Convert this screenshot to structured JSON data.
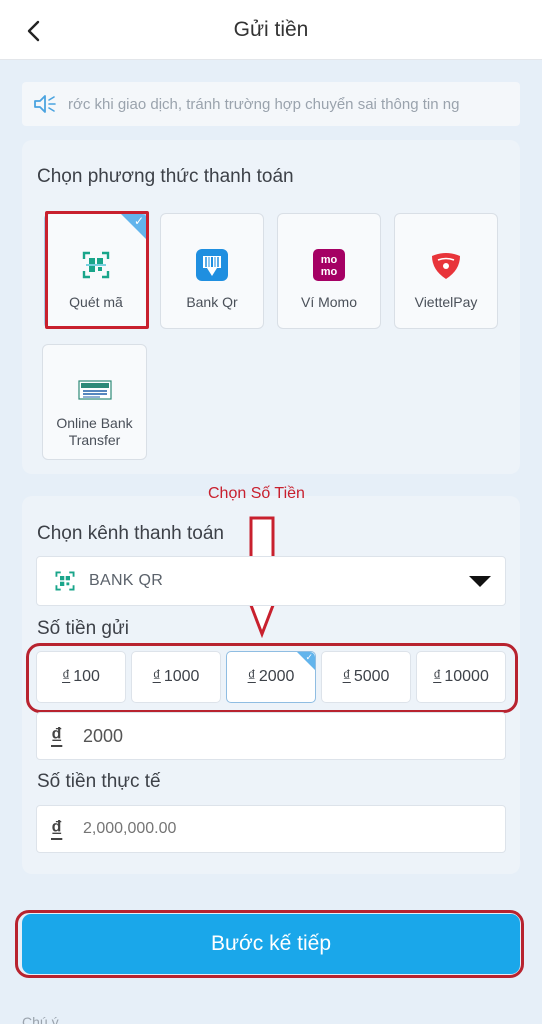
{
  "header": {
    "title": "Gửi tiền",
    "back_icon": "chevron-left-icon"
  },
  "notice": {
    "icon": "speaker-icon",
    "text": "rớc khi giao dịch, tránh trường hợp chuyển sai thông tin ng"
  },
  "methods": {
    "label": "Chọn phương thức thanh toán",
    "items": [
      {
        "label": "Quét mã",
        "icon": "qr-scan-icon",
        "selected": true
      },
      {
        "label": "Bank Qr",
        "icon": "bank-qr-icon",
        "selected": false
      },
      {
        "label": "Ví Momo",
        "icon": "momo-icon",
        "selected": false
      },
      {
        "label": "ViettelPay",
        "icon": "viettelpay-icon",
        "selected": false
      },
      {
        "label": "Online Bank Transfer",
        "icon": "bank-transfer-icon",
        "selected": false
      }
    ]
  },
  "annotation": {
    "text": "Chọn Số Tiền"
  },
  "channel": {
    "label": "Chọn kênh thanh toán",
    "selected": "BANK QR",
    "icon": "qr-scan-icon"
  },
  "amount": {
    "label": "Số tiền gửi",
    "currency_symbol": "₫",
    "options": [
      "100",
      "1000",
      "2000",
      "5000",
      "10000"
    ],
    "selected": "2000",
    "input_value": "2000"
  },
  "actual": {
    "label": "Số tiền thực tế",
    "placeholder": "2,000,000.00"
  },
  "next_button": {
    "label": "Bước kế tiếp"
  },
  "note": {
    "text": "Chú ý"
  },
  "colors": {
    "accent": "#1aa7ea",
    "annotation": "#c8202e",
    "momo": "#a50064",
    "viettel": "#e8343a"
  }
}
